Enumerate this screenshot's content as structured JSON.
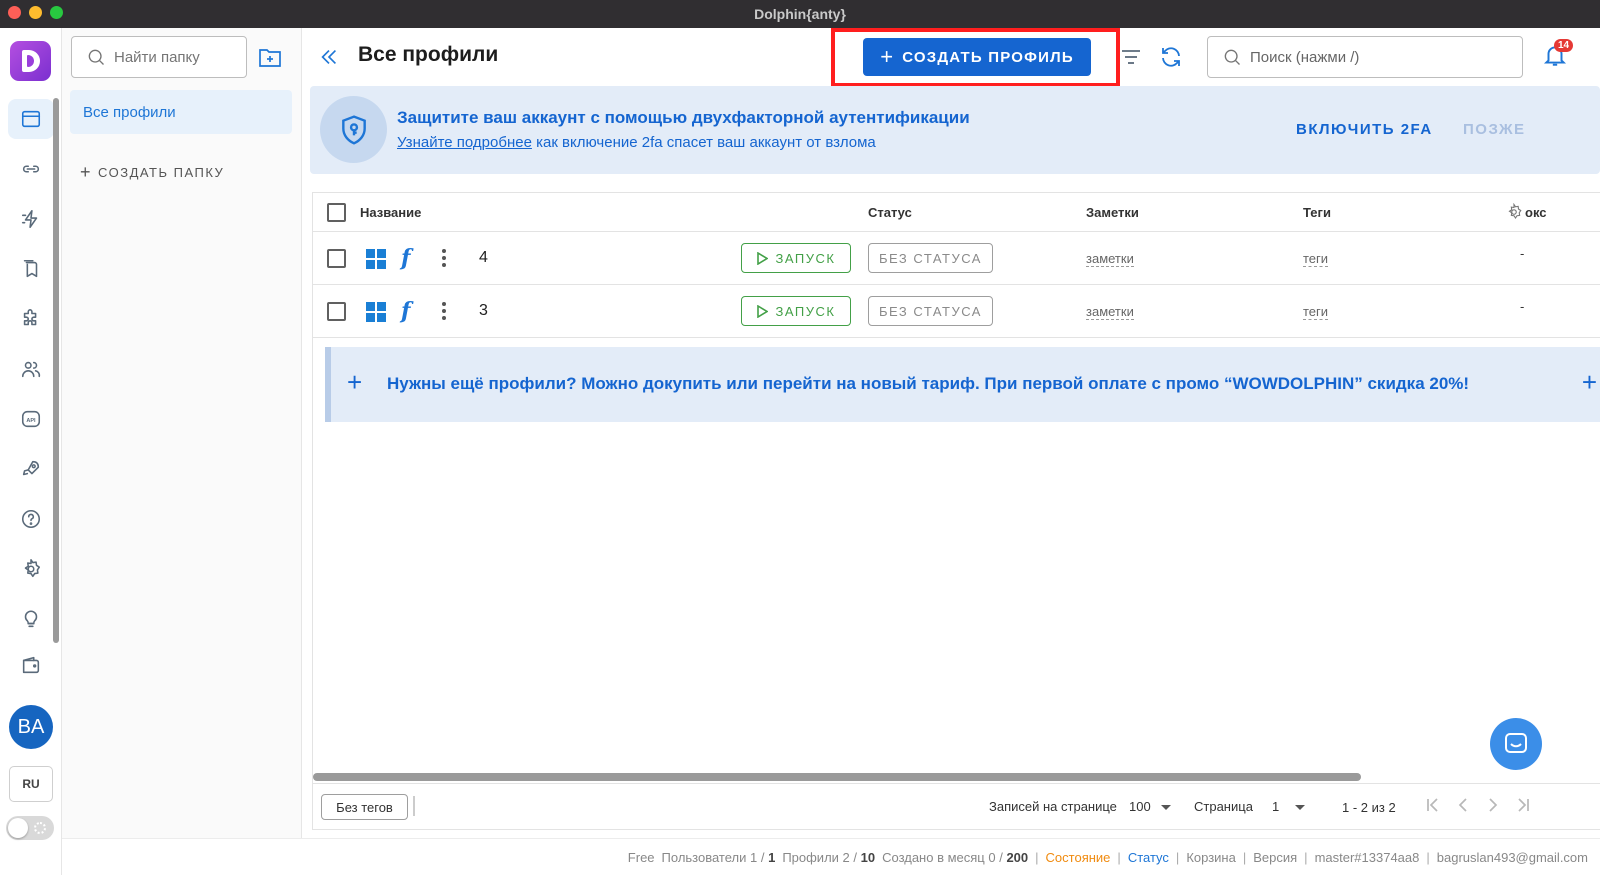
{
  "window": {
    "title": "Dolphin{anty}"
  },
  "rail": {
    "items": [
      "browser-profiles-icon",
      "link-icon",
      "automation-icon",
      "bookmarks-icon",
      "extensions-icon",
      "team-icon",
      "api-icon",
      "rocket-icon",
      "help-icon",
      "settings-icon",
      "bulb-icon",
      "wallet-icon"
    ],
    "avatar": "BA",
    "lang": "RU"
  },
  "folders": {
    "search_placeholder": "Найти папку",
    "items": [
      {
        "label": "Все профили"
      }
    ],
    "create_label": "СОЗДАТЬ ПАПКУ"
  },
  "header": {
    "title": "Все профили",
    "create_label": "СОЗДАТЬ ПРОФИЛЬ",
    "search_placeholder": "Поиск (нажми /)",
    "notifications": "14"
  },
  "banner": {
    "title": "Защитите ваш аккаунт с помощью двухфакторной аутентификации",
    "link": "Узнайте подробнее",
    "subtitle": "как включение 2fa спасет ваш аккаунт от взлома",
    "enable_label": "ВКЛЮЧИТЬ 2FA",
    "later_label": "ПОЗЖЕ"
  },
  "table": {
    "columns": {
      "name": "Название",
      "status": "Статус",
      "notes": "Заметки",
      "tags": "Теги",
      "proxy": "окс"
    },
    "rows": [
      {
        "name": "4",
        "run": "ЗАПУСК",
        "status": "БЕЗ СТАТУСА",
        "notes": "заметки",
        "tags": "теги",
        "proxy": "-"
      },
      {
        "name": "3",
        "run": "ЗАПУСК",
        "status": "БЕЗ СТАТУСА",
        "notes": "заметки",
        "tags": "теги",
        "proxy": "-"
      }
    ],
    "promo": "Нужны ещё профили? Можно докупить или перейти на новый тариф. При первой оплате с промо “WOWDOLPHIN” скидка 20%!"
  },
  "footer": {
    "no_tags": "Без тегов",
    "per_page_label": "Записей на странице",
    "per_page": "100",
    "page_label": "Страница",
    "page": "1",
    "range": "1 - 2 из 2"
  },
  "statusbar": {
    "plan": "Free",
    "users_label": "Пользователи 1 /",
    "users_max": "1",
    "profiles_label": "Профили 2 /",
    "profiles_max": "10",
    "created_label": "Создано в месяц 0 /",
    "created_max": "200",
    "state": "Состояние",
    "status": "Статус",
    "trash": "Корзина",
    "version": "Версия",
    "build": "master#13374aa8",
    "email": "bagruslan493@gmail.com"
  },
  "colors": {
    "accent": "#1565d0",
    "highlight": "#ff1e1e",
    "run": "#43a047"
  }
}
